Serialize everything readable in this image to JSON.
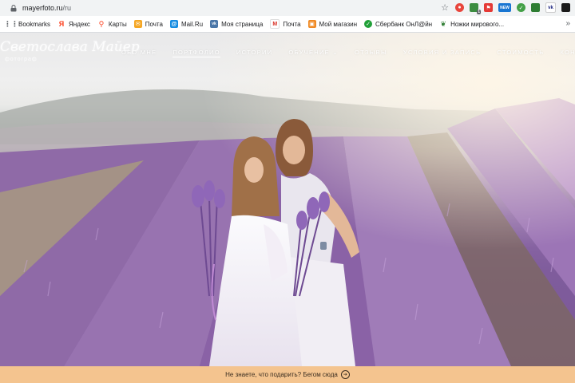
{
  "browser": {
    "url_host": "mayerfoto.ru",
    "url_path": "/ru",
    "extension_badges": {
      "new": "NEW",
      "count": "1"
    }
  },
  "bookmarks": [
    {
      "label": "Bookmarks",
      "icon": "apps-grid-icon",
      "color": "#5f6368"
    },
    {
      "label": "Яндекс",
      "icon": "yandex-icon",
      "color": "#fc3f1d"
    },
    {
      "label": "Карты",
      "icon": "map-pin-icon",
      "color": "#fc3f1d"
    },
    {
      "label": "Почта",
      "icon": "mail-icon",
      "color": "#f5a623"
    },
    {
      "label": "Mail.Ru",
      "icon": "mailru-icon",
      "color": "#168de2"
    },
    {
      "label": "Моя страница",
      "icon": "vk-icon",
      "color": "#4a76a8"
    },
    {
      "label": "Почта",
      "icon": "gmail-icon",
      "color": "#d93025"
    },
    {
      "label": "Мой магазин",
      "icon": "shop-icon",
      "color": "#f08a24"
    },
    {
      "label": "Сбербанк ОнЛ@йн",
      "icon": "sberbank-icon",
      "color": "#21a038"
    },
    {
      "label": "Ножки мирового...",
      "icon": "leaf-icon",
      "color": "#2e7d32"
    }
  ],
  "site": {
    "logo_text": "Светослава Майер",
    "logo_sub": "фотограф",
    "nav": [
      {
        "label": "ОБО МНЕ",
        "active": false
      },
      {
        "label": "ПОРТФОЛИО",
        "active": true
      },
      {
        "label": "ИСТОРИИ",
        "active": false
      },
      {
        "label": "ОБУЧЕНИЕ",
        "active": false
      },
      {
        "label": "ОТЗЫВЫ",
        "active": false
      },
      {
        "label": "УСЛОВИЯ И ЗАПИСЬ",
        "active": false
      },
      {
        "label": "СТОИМОСТЬ",
        "active": false
      },
      {
        "label": "КОНТАКТЫ",
        "active": false
      }
    ]
  },
  "banner": {
    "text": "Не знаете, что подарить? Бегом сюда",
    "color": "#f4c48f"
  }
}
